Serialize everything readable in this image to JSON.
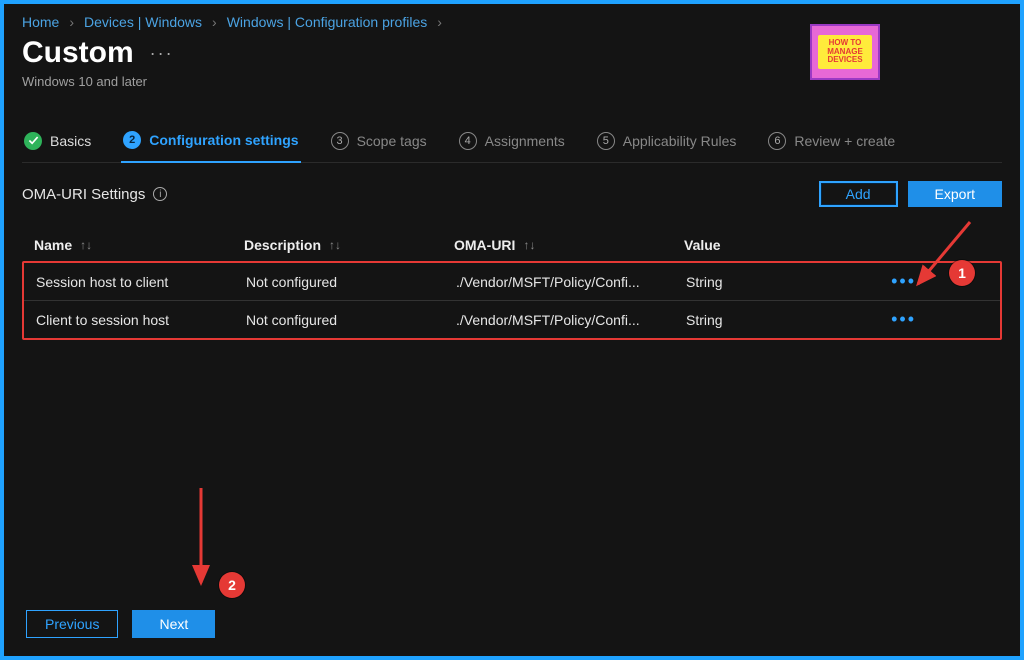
{
  "breadcrumb": {
    "items": [
      {
        "label": "Home"
      },
      {
        "label": "Devices | Windows"
      },
      {
        "label": "Windows | Configuration profiles"
      }
    ]
  },
  "header": {
    "title": "Custom",
    "subtitle": "Windows 10 and later"
  },
  "logo": {
    "line1": "HOW TO",
    "line2": "MANAGE",
    "line3": "DEVICES"
  },
  "tabs": [
    {
      "num": "✓",
      "label": "Basics",
      "state": "done"
    },
    {
      "num": "2",
      "label": "Configuration settings",
      "state": "active"
    },
    {
      "num": "3",
      "label": "Scope tags",
      "state": "pending"
    },
    {
      "num": "4",
      "label": "Assignments",
      "state": "pending"
    },
    {
      "num": "5",
      "label": "Applicability Rules",
      "state": "pending"
    },
    {
      "num": "6",
      "label": "Review + create",
      "state": "pending"
    }
  ],
  "section": {
    "label": "OMA-URI Settings",
    "add_label": "Add",
    "export_label": "Export"
  },
  "table": {
    "headers": {
      "name": "Name",
      "description": "Description",
      "omauri": "OMA-URI",
      "value": "Value"
    },
    "rows": [
      {
        "name": "Session host to client",
        "description": "Not configured",
        "omauri": "./Vendor/MSFT/Policy/Confi...",
        "value": "String"
      },
      {
        "name": "Client to session host",
        "description": "Not configured",
        "omauri": "./Vendor/MSFT/Policy/Confi...",
        "value": "String"
      }
    ]
  },
  "footer": {
    "previous": "Previous",
    "next": "Next"
  },
  "annotations": {
    "callout1": "1",
    "callout2": "2"
  }
}
